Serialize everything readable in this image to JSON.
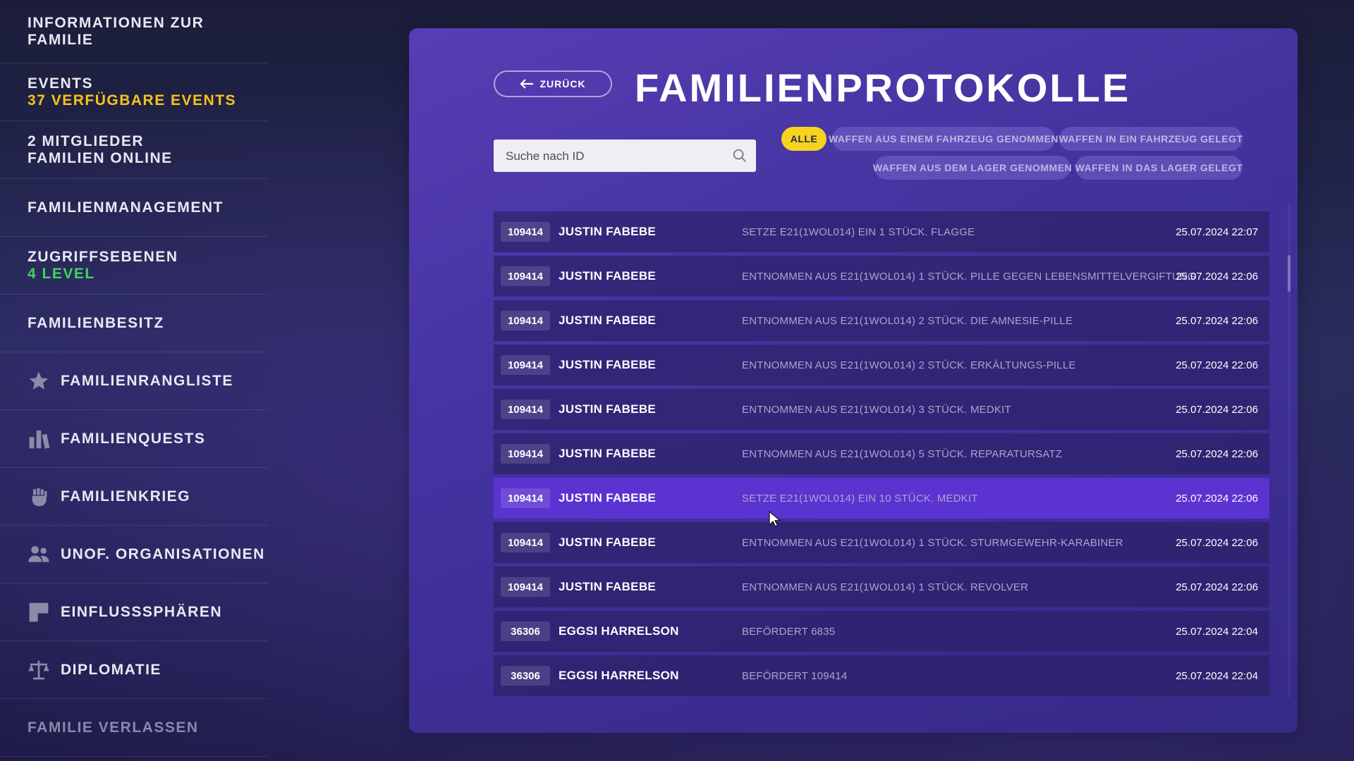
{
  "sidebar": {
    "items": [
      {
        "title": "INFORMATIONEN ZUR FAMILIE",
        "sub": ""
      },
      {
        "title": "EVENTS",
        "sub": "37 VERFÜGBARE EVENTS"
      },
      {
        "title": "2 MITGLIEDER",
        "sub": "FAMILIEN ONLINE"
      },
      {
        "title": "FAMILIENMANAGEMENT",
        "sub": ""
      },
      {
        "title": "ZUGRIFFSEBENEN",
        "sub": "4 LEVEL"
      },
      {
        "title": "FAMILIENBESITZ",
        "sub": ""
      },
      {
        "title": "FAMILIENRANGLISTE",
        "icon": "star-icon"
      },
      {
        "title": "FAMILIENQUESTS",
        "icon": "bar-chart-icon"
      },
      {
        "title": "FAMILIENKRIEG",
        "icon": "fist-icon"
      },
      {
        "title": "UNOF. ORGANISATIONEN",
        "icon": "people-icon"
      },
      {
        "title": "EINFLUSSSPHÄREN",
        "icon": "flag-icon"
      },
      {
        "title": "DIPLOMATIE",
        "icon": "scales-icon"
      },
      {
        "title": "FAMILIE VERLASSEN",
        "sub": ""
      }
    ]
  },
  "header": {
    "back_label": "ZURÜCK",
    "title": "FAMILIENPROTOKOLLE"
  },
  "search": {
    "placeholder": "Suche nach ID"
  },
  "filters": [
    {
      "label": "ALLE",
      "active": true
    },
    {
      "label": "WAFFEN AUS EINEM FAHRZEUG GENOMMEN",
      "active": false
    },
    {
      "label": "WAFFEN IN EIN FAHRZEUG GELEGT",
      "active": false
    },
    {
      "label": "WAFFEN AUS DEM LAGER GENOMMEN",
      "active": false
    },
    {
      "label": "WAFFEN IN DAS LAGER GELEGT",
      "active": false
    }
  ],
  "log": {
    "rows": [
      {
        "id": "109414",
        "name": "JUSTIN FABEBE",
        "desc": "SETZE E21(1WOL014) EIN 1 STÜCK. FLAGGE",
        "date": "25.07.2024 22:07"
      },
      {
        "id": "109414",
        "name": "JUSTIN FABEBE",
        "desc": "ENTNOMMEN AUS E21(1WOL014) 1 STÜCK. PILLE GEGEN LEBENSMITTELVERGIFTUNG",
        "date": "25.07.2024 22:06"
      },
      {
        "id": "109414",
        "name": "JUSTIN FABEBE",
        "desc": "ENTNOMMEN AUS E21(1WOL014) 2 STÜCK. DIE AMNESIE-PILLE",
        "date": "25.07.2024 22:06"
      },
      {
        "id": "109414",
        "name": "JUSTIN FABEBE",
        "desc": "ENTNOMMEN AUS E21(1WOL014) 2 STÜCK. ERKÄLTUNGS-PILLE",
        "date": "25.07.2024 22:06"
      },
      {
        "id": "109414",
        "name": "JUSTIN FABEBE",
        "desc": "ENTNOMMEN AUS E21(1WOL014) 3 STÜCK. MEDKIT",
        "date": "25.07.2024 22:06"
      },
      {
        "id": "109414",
        "name": "JUSTIN FABEBE",
        "desc": "ENTNOMMEN AUS E21(1WOL014) 5 STÜCK. REPARATURSATZ",
        "date": "25.07.2024 22:06"
      },
      {
        "id": "109414",
        "name": "JUSTIN FABEBE",
        "desc": "SETZE E21(1WOL014) EIN 10 STÜCK. MEDKIT",
        "date": "25.07.2024 22:06",
        "hover": true
      },
      {
        "id": "109414",
        "name": "JUSTIN FABEBE",
        "desc": "ENTNOMMEN AUS E21(1WOL014) 1 STÜCK. STURMGEWEHR-KARABINER",
        "date": "25.07.2024 22:06"
      },
      {
        "id": "109414",
        "name": "JUSTIN FABEBE",
        "desc": "ENTNOMMEN AUS E21(1WOL014) 1 STÜCK. REVOLVER",
        "date": "25.07.2024 22:06"
      },
      {
        "id": "36306",
        "name": "EGGSI HARRELSON",
        "desc": "BEFÖRDERT 6835",
        "date": "25.07.2024 22:04"
      },
      {
        "id": "36306",
        "name": "EGGSI HARRELSON",
        "desc": "BEFÖRDERT 109414",
        "date": "25.07.2024 22:04"
      }
    ]
  },
  "colors": {
    "accent_yellow": "#f5c31c",
    "accent_green": "#3fd45e",
    "row_hover": "#5a33d1",
    "filter_active": "#f7d21e"
  }
}
